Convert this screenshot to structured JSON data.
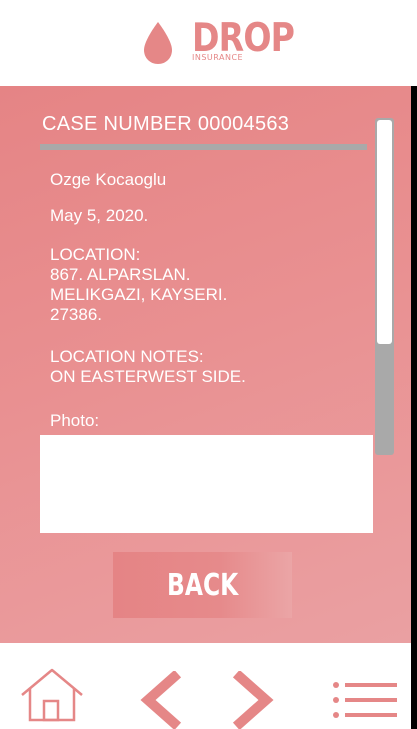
{
  "header": {
    "logo_word": "DROP",
    "logo_sub": "INSURANCE",
    "logo_icon": "water-drop-icon"
  },
  "case": {
    "title": "CASE NUMBER 00004563",
    "name": "Ozge Kocaoglu",
    "date": "May 5, 2020.",
    "location_label": "LOCATION:",
    "location_line1": "867. ALPARSLAN.",
    "location_line2": "MELIKGAZI, KAYSERI.",
    "location_line3": "27386.",
    "notes_label": "LOCATION NOTES:",
    "notes_text": "ON EASTERWEST SIDE.",
    "photo_label": "Photo:"
  },
  "actions": {
    "back_label": "BACK"
  },
  "nav": {
    "items": [
      "home-icon",
      "chevron-left-icon",
      "chevron-right-icon",
      "menu-icon"
    ]
  },
  "colors": {
    "accent": "#e58787",
    "panel": "#e99091",
    "divider": "#a9a9a9"
  }
}
